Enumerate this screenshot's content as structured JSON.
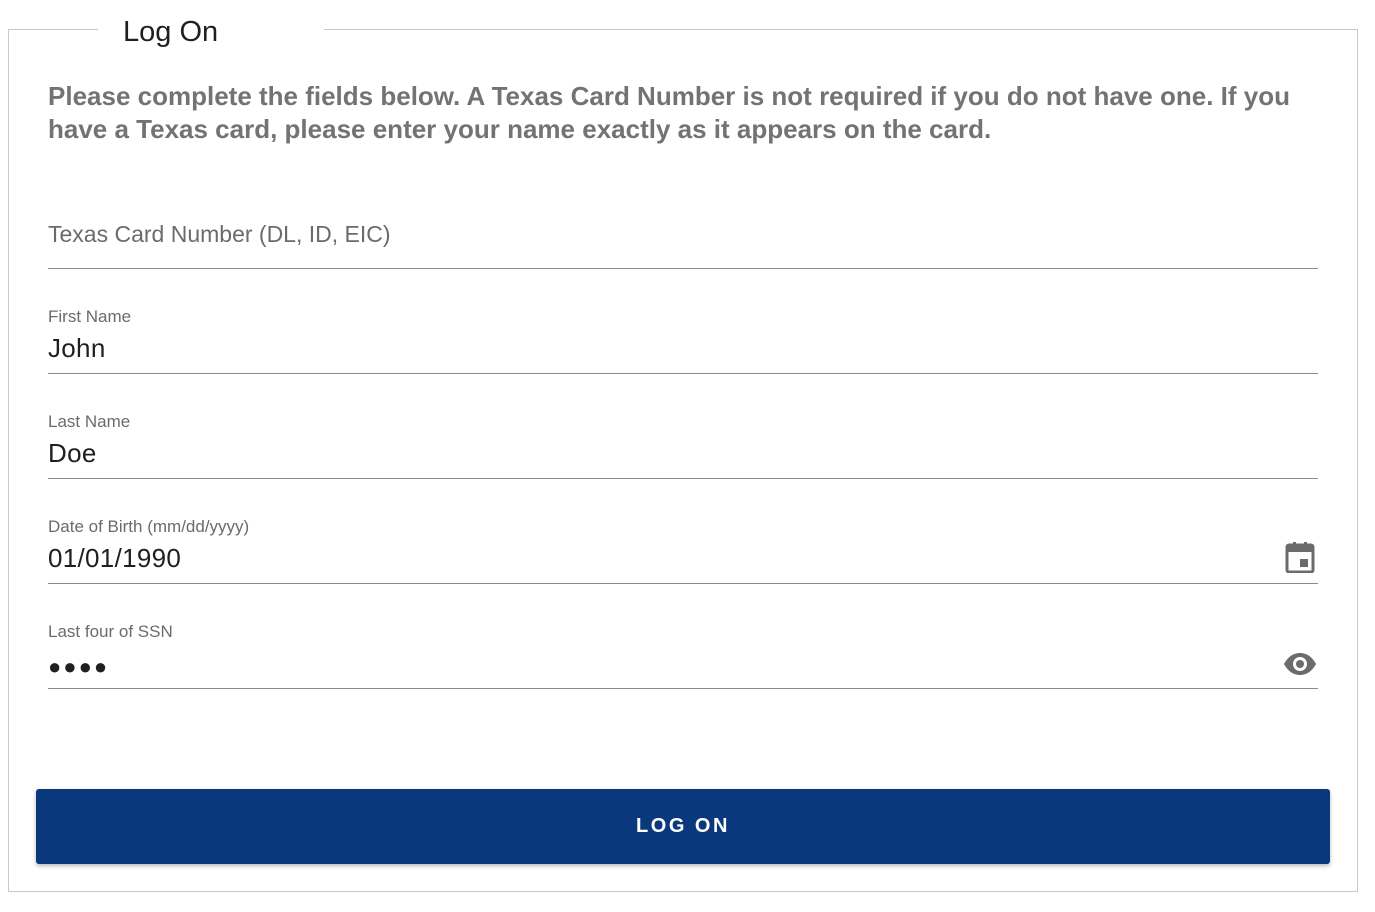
{
  "form": {
    "legend": "Log On",
    "intro": "Please complete the fields below. A Texas Card Number is not required if you do not have one. If you have a Texas card, please enter your name exactly as it appears on the card.",
    "card_number": {
      "label": "",
      "placeholder": "Texas Card Number (DL, ID, EIC)",
      "value": ""
    },
    "first_name": {
      "label": "First Name",
      "value": "John"
    },
    "last_name": {
      "label": "Last Name",
      "value": "Doe"
    },
    "dob": {
      "label": "Date of Birth (mm/dd/yyyy)",
      "value": "01/01/1990",
      "icon": "calendar-icon"
    },
    "ssn": {
      "label": "Last four of SSN",
      "value": "●●●●",
      "icon": "eye-icon"
    },
    "submit_label": "LOG ON"
  },
  "colors": {
    "primary_button": "#0a387d",
    "intro_text": "#737373",
    "icon": "#6b6b6b"
  }
}
